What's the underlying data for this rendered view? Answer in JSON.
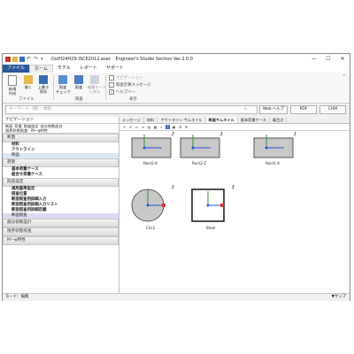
{
  "window": {
    "title": "DoiH24H29-ISCE2012.esec - Engineer's Studio Section Ver.2.0.0",
    "controls": [
      "—",
      "☐",
      "✕"
    ]
  },
  "menu": {
    "file": "ファイル",
    "home": "ホーム",
    "model": "モデル",
    "report": "レポート",
    "support": "サポート"
  },
  "ribbon": {
    "new_label": "新規\n作成",
    "open_label": "開く",
    "save_label": "上書き\n保存",
    "check_label": "照査\nチェック",
    "calc_label": "照査",
    "edit_mode_label": "編集モード\nに戻る",
    "group_file": "ファイル",
    "group_check": "照査",
    "group_view": "表示",
    "chk_navigation": "ナビゲーション",
    "chk_message": "照査計算メッセージ",
    "chk_help": "ヘルプバー"
  },
  "search": {
    "placeholder": "キーワード（例）：材料",
    "web_help": "Web ヘルプ",
    "pdf": "PDF",
    "chm": "CHM"
  },
  "nav": {
    "header": "ナビゲーション",
    "tabs_row1": [
      "断面",
      "荷重",
      "照査設定",
      "部分係数設計"
    ],
    "tabs_row2": [
      "限界状態照査",
      "M〜φ特性"
    ],
    "sections": [
      {
        "label": "断面",
        "items": [
          {
            "label": "材料",
            "style": "b"
          },
          {
            "label": "アウトライン",
            "style": "b"
          },
          {
            "label": "断面",
            "style": "sel"
          }
        ]
      },
      {
        "label": "荷重",
        "items": [
          {
            "label": "基本荷重ケース",
            "style": "b"
          },
          {
            "label": "組合せ荷重ケース",
            "style": "b"
          }
        ]
      },
      {
        "label": "照査設定",
        "items": [
          {
            "label": "適用基準設定",
            "style": "b"
          },
          {
            "label": "照査位置",
            "style": "b"
          },
          {
            "label": "断面照査用詳細入力",
            "style": "b"
          },
          {
            "label": "断面照査用詳細入力リスト",
            "style": "b"
          },
          {
            "label": "断面照査用詳細定義",
            "style": "b"
          },
          {
            "label": "断面照査",
            "style": "hl"
          }
        ]
      },
      {
        "label": "部分係数設計",
        "items": []
      },
      {
        "label": "限界状態照査",
        "items": []
      },
      {
        "label": "M〜φ特性",
        "items": []
      }
    ]
  },
  "main": {
    "tabs": [
      {
        "label": "メッセージ",
        "on": false
      },
      {
        "label": "材料",
        "on": false
      },
      {
        "label": "アウトライン サムネイル",
        "on": false
      },
      {
        "label": "断面サムネイル",
        "on": true
      },
      {
        "label": "基本荷重ケース",
        "on": false
      },
      {
        "label": "着目点",
        "on": false
      }
    ],
    "thumbnails": [
      {
        "label": "Rect2-X",
        "shape": "rect"
      },
      {
        "label": "Rect2-Z",
        "shape": "rect"
      },
      {
        "label": "Rect1-X",
        "shape": "rect"
      },
      {
        "label": "Circ1",
        "shape": "circle"
      },
      {
        "label": "Steel",
        "shape": "box"
      }
    ]
  },
  "status": {
    "left": "モード：編集",
    "right": "▼サンプ"
  }
}
